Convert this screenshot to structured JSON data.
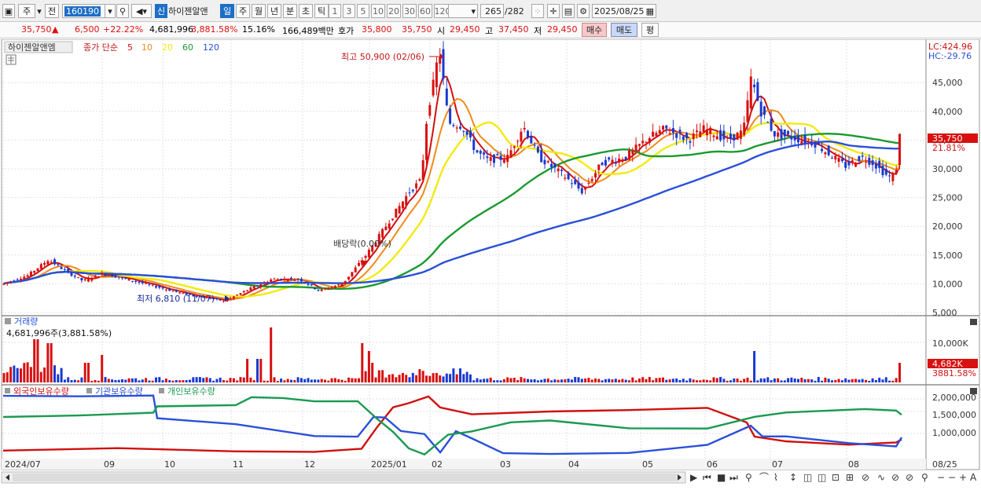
{
  "toolbar": {
    "mode_label": "전",
    "code": "160190",
    "sin_label": "신",
    "stock_name": "하이젠알앤",
    "periods": [
      "일",
      "주",
      "월",
      "년",
      "분",
      "초",
      "틱"
    ],
    "active_period": "일",
    "minutes": [
      "1",
      "3",
      "5",
      "10",
      "20",
      "30",
      "60",
      "120"
    ],
    "count": "265",
    "total": "/282",
    "date": "2025/08/25"
  },
  "quote": {
    "price": "35,750",
    "change": "6,500",
    "change_pct": "+22.22%",
    "volume": "4,681,996",
    "vol_pct": "3,881.58%",
    "turnover": "15.16%",
    "amount": "166,489백만",
    "hoga_label": "호가",
    "ask": "35,800",
    "bid": "35,750",
    "open_label": "시",
    "open": "29,450",
    "high_label": "고",
    "high": "37,450",
    "low_label": "저",
    "low": "29,450",
    "buy_btn": "매수",
    "sell_btn": "매도",
    "eval_btn": "평"
  },
  "chart": {
    "stock_tag": "하이젠알앤엠",
    "legend_prefix": "종가 단순",
    "ma_periods": [
      "5",
      "10",
      "20",
      "60",
      "120"
    ],
    "ma_colors": [
      "#d01010",
      "#ee8a1a",
      "#f2ea10",
      "#1a9a30",
      "#2a50d8"
    ],
    "lc": "LC:424.96",
    "hc": "HC:-29.76",
    "high_note": "최고 50,900 (02/06)",
    "low_note": "최저 6,810 (11/07)",
    "dividend_note": "배당락(0.00%)",
    "current_price_tag": "35,750",
    "current_pct_tag": "21.81%",
    "y_ticks": [
      "45,000",
      "40,000",
      "35,000",
      "30,000",
      "25,000",
      "20,000",
      "15,000",
      "10,000",
      "5,000"
    ],
    "volume_title": "거래량",
    "volume_value": "4,681,996주(3,881.58%)",
    "volume_tick": "10,000K",
    "volume_tag": "4,682K",
    "volume_pct_tag": "3881.58%",
    "holdings_legend": [
      "외국인보유수량",
      "기관보유수량",
      "개인보유수량"
    ],
    "holdings_colors": [
      "#d01010",
      "#2a50d8",
      "#1a9a50"
    ],
    "holdings_ticks": [
      "2,000,000",
      "1,500,000",
      "1,000,000"
    ],
    "x_labels": [
      "2024/07",
      "09",
      "10",
      "11",
      "12",
      "2025/01",
      "02",
      "03",
      "04",
      "05",
      "06",
      "07",
      "08",
      "08/25"
    ]
  },
  "chart_data": {
    "type": "candlestick",
    "price_series": {
      "dates": [
        "2024/07",
        "2024/08",
        "2024/09",
        "2024/10",
        "2024/11",
        "2024/12",
        "2025/01",
        "2025/02",
        "2025/03",
        "2025/04",
        "2025/05",
        "2025/06",
        "2025/07",
        "2025/08",
        "2025/08/25"
      ],
      "close": [
        9800,
        13500,
        11200,
        9500,
        7800,
        11000,
        11500,
        43000,
        32000,
        28000,
        33000,
        37000,
        34000,
        30000,
        35750
      ]
    },
    "high_point": {
      "date": "02/06",
      "value": 50900
    },
    "low_point": {
      "date": "11/07",
      "value": 6810
    },
    "ylim": [
      5000,
      50900
    ]
  }
}
